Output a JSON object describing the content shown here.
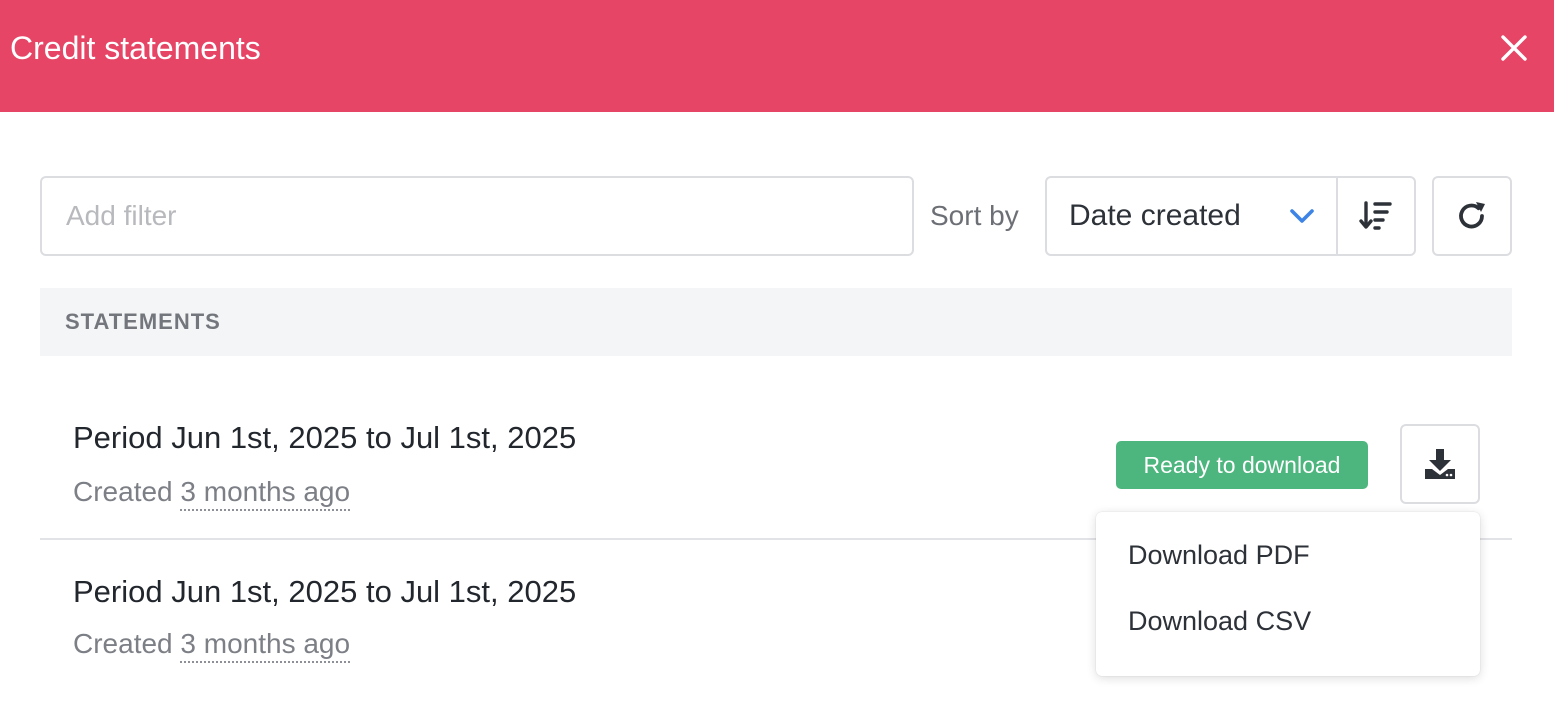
{
  "colors": {
    "header_bg": "#e64566",
    "badge_ready": "#4db57e",
    "chevron": "#3d84e6"
  },
  "header": {
    "title": "Credit statements",
    "close_icon": "close-icon"
  },
  "toolbar": {
    "filter_placeholder": "Add filter",
    "sort_label": "Sort by",
    "sort_value": "Date created",
    "sort_chevron_icon": "chevron-down-icon",
    "sort_direction_icon": "sort-descending-icon",
    "refresh_icon": "refresh-icon"
  },
  "section": {
    "title": "STATEMENTS"
  },
  "statements": [
    {
      "title": "Period Jun 1st, 2025 to Jul 1st, 2025",
      "created_label": "Created",
      "created_relative": "3 months ago",
      "status": "Ready to download",
      "download_icon": "download-icon"
    },
    {
      "title": "Period Jun 1st, 2025 to Jul 1st, 2025",
      "created_label": "Created",
      "created_relative": "3 months ago"
    }
  ],
  "download_menu": {
    "items": [
      "Download PDF",
      "Download CSV"
    ]
  }
}
